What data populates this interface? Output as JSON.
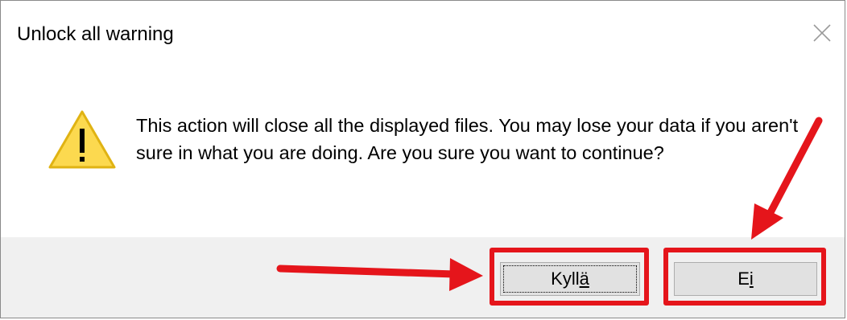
{
  "dialog": {
    "title": "Unlock all warning",
    "close_icon": "close-icon",
    "warning_icon": "warning-icon",
    "message": "This action will close all the displayed files. You may lose your data if you aren't sure in what you are doing. Are you sure you want to continue?"
  },
  "buttons": {
    "yes": {
      "label_prefix": "Kyll",
      "mnemonic": "ä",
      "label_suffix": "",
      "focused": true
    },
    "no": {
      "label_prefix": "E",
      "mnemonic": "i",
      "label_suffix": ""
    }
  },
  "annotations": {
    "highlight_color": "#e5151b",
    "arrows": [
      "arrow-to-yes-button",
      "arrow-to-no-button"
    ]
  },
  "colors": {
    "footer_bg": "#f0f0f0",
    "button_bg": "#e1e1e1",
    "button_border": "#adadad",
    "warning_fill": "#fcd94f",
    "annotation_red": "#e5151b"
  }
}
